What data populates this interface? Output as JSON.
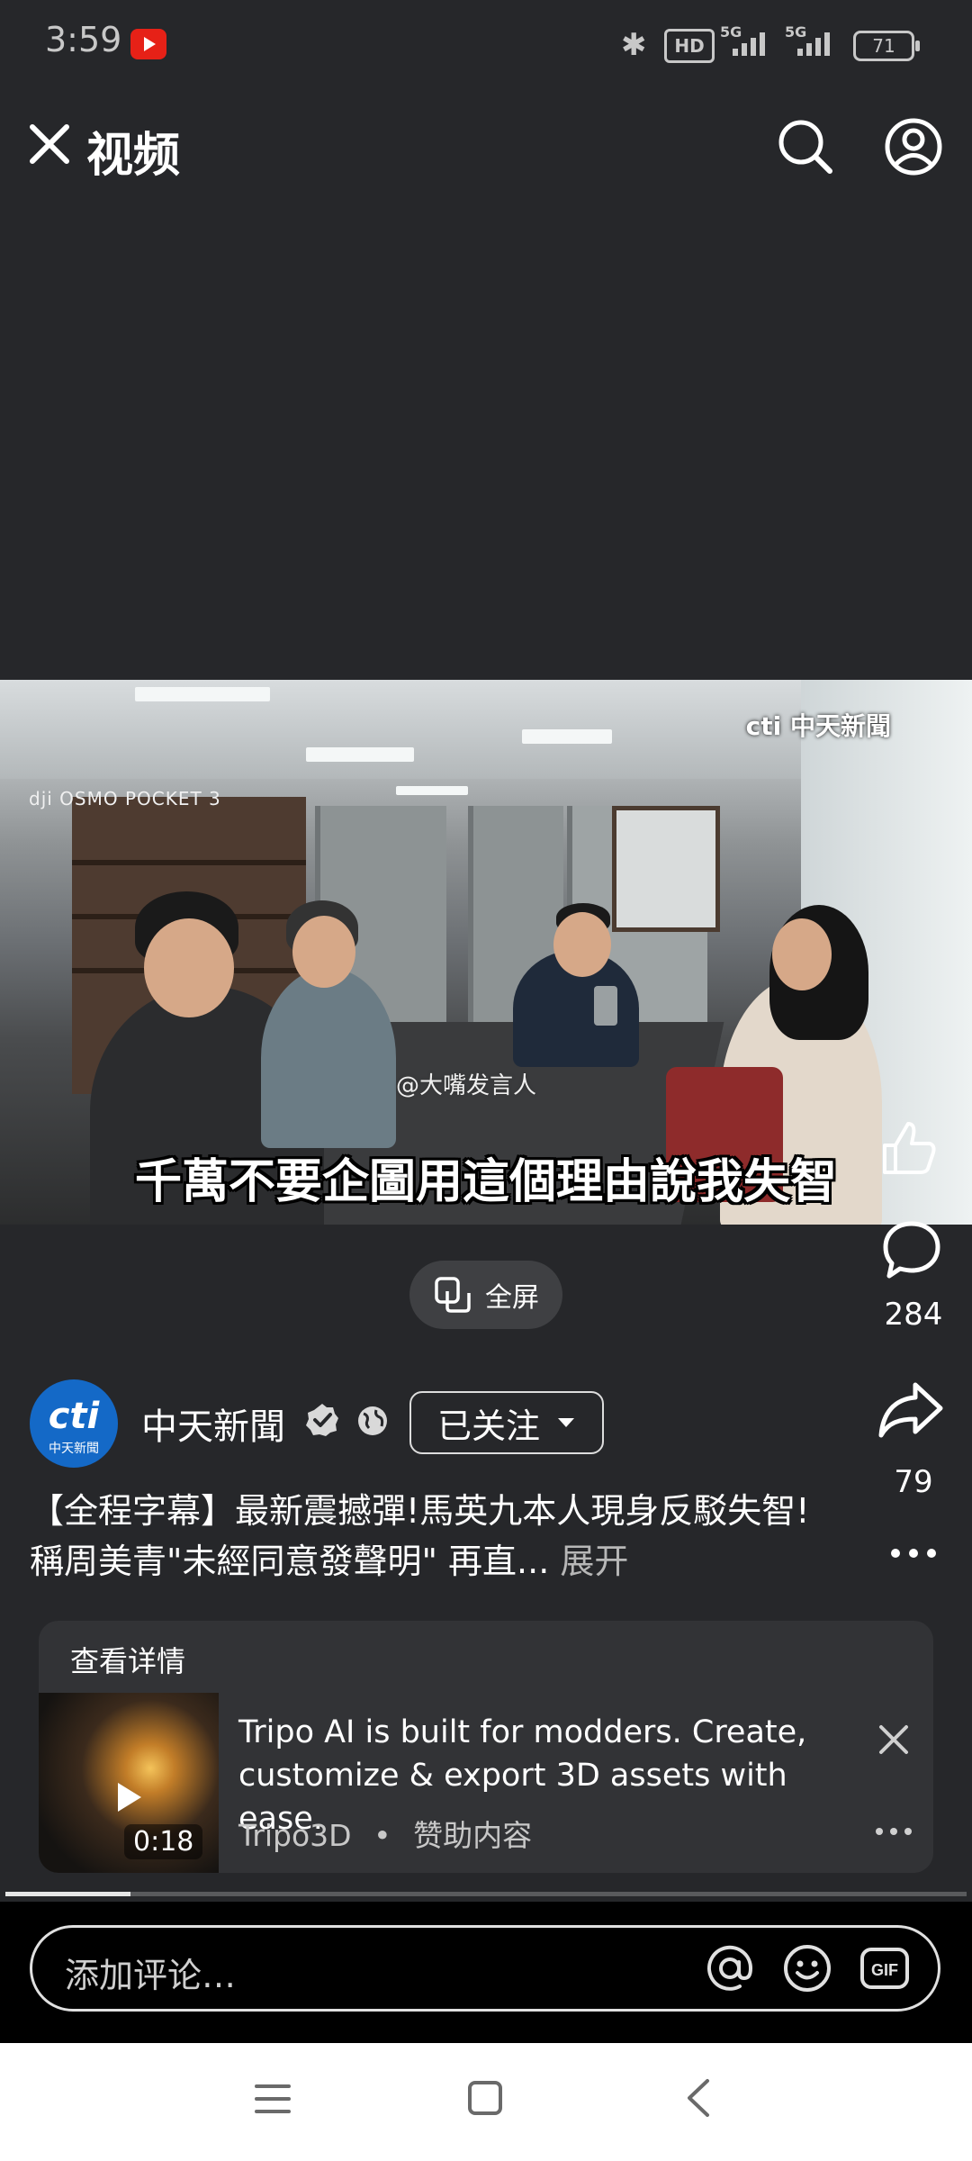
{
  "status_bar": {
    "time": "3:59",
    "network_1": "5G",
    "network_2": "5G",
    "hd_label": "HD",
    "battery": "71"
  },
  "header": {
    "title": "视频"
  },
  "video": {
    "channel_watermark": "中天新聞",
    "camera_watermark": "OSMO POCKET 3",
    "weibo_watermark": "@大嘴发言人",
    "subtitle": "千萬不要企圖用這個理由說我失智"
  },
  "actions": {
    "comment_count": "284",
    "share_count": "79"
  },
  "fullscreen": {
    "label": "全屏"
  },
  "channel": {
    "avatar_logo": "cti",
    "avatar_sub": "中天新聞",
    "name": "中天新聞",
    "follow_label": "已关注"
  },
  "title": {
    "text": "【全程字幕】最新震撼彈!馬英九本人現身反駁失智!稱周美青\"未經同意發聲明\" 再直...",
    "expand_label": "展开"
  },
  "ad": {
    "header": "查看详情",
    "duration": "0:18",
    "text": "Tripo AI is built for modders. Create, customize & export 3D assets with ease.",
    "advertiser": "Tripo3D",
    "separator": "•",
    "sponsored_label": "赞助内容"
  },
  "comment_box": {
    "placeholder": "添加评论…"
  },
  "progress": {
    "watched_fraction": 0.13
  },
  "icons": [
    "close-icon",
    "search-icon",
    "account-icon",
    "like-icon",
    "comment-icon",
    "share-icon",
    "more-icon",
    "fullscreen-icon",
    "verified-icon",
    "globe-icon",
    "chevron-down-icon",
    "play-icon",
    "mention-icon",
    "emoji-icon",
    "gif-icon",
    "menu-icon",
    "home-icon",
    "back-icon"
  ]
}
